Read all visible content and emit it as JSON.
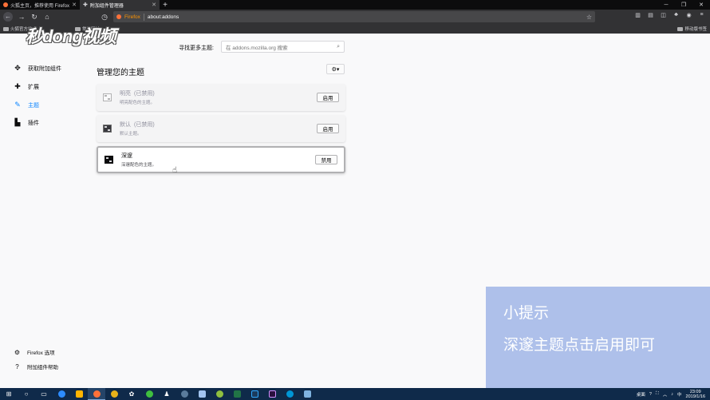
{
  "tabs": [
    {
      "label": "火狐主页，推荐使用 Firefox 浏...",
      "icon": "firefox-icon",
      "active": false
    },
    {
      "label": "附加组件管理器",
      "icon": "puzzle-icon",
      "active": true
    }
  ],
  "urlbar": {
    "brand": "Firefox",
    "url": "about:addons"
  },
  "bookmarks": {
    "items": [
      "火狐官方站点",
      "常用网址"
    ],
    "right": "移动版书签"
  },
  "watermark": "秒dong视频",
  "sidebar": {
    "items": [
      {
        "label": "获取附加组件",
        "icon": "get-addons-icon"
      },
      {
        "label": "扩展",
        "icon": "puzzle-icon"
      },
      {
        "label": "主题",
        "icon": "brush-icon"
      },
      {
        "label": "插件",
        "icon": "plugin-icon"
      }
    ],
    "footer": [
      {
        "label": "Firefox 选项",
        "icon": "gear-icon"
      },
      {
        "label": "附加组件帮助",
        "icon": "help-icon"
      }
    ]
  },
  "search": {
    "label": "寻找更多主题:",
    "placeholder": "在 addons.mozilla.org 搜索"
  },
  "main": {
    "title": "管理您的主题",
    "themes": [
      {
        "name": "明亮",
        "status": "(已禁用)",
        "desc": "明亮配色的主题。",
        "button": "启用"
      },
      {
        "name": "默认",
        "status": "(已禁用)",
        "desc": "默认主题。",
        "button": "启用"
      },
      {
        "name": "深邃",
        "status": "",
        "desc": "深邃配色的主题。",
        "button": "禁用"
      }
    ]
  },
  "tip": {
    "title": "小提示",
    "body": "深邃主题点击启用即可"
  },
  "taskbar": {
    "tray": {
      "lang": "中",
      "time": "23:09",
      "date": "2019/1/16",
      "label": "桌面"
    }
  },
  "colors": {
    "accent": "#0a84ff",
    "tip_bg": "#aec0ea",
    "taskbar": "#0f2a4a"
  }
}
